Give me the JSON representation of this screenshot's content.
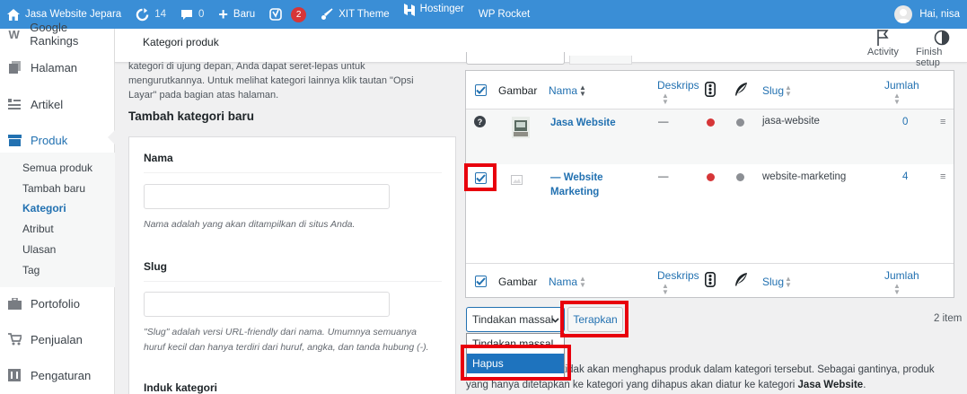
{
  "adminbar": {
    "site_name": "Jasa Website Jepara",
    "updates_count": "14",
    "comments_count": "0",
    "new_label": "Baru",
    "yoast_badge": "2",
    "xit_theme": "XIT Theme",
    "hostinger": "Hostinger",
    "wp_rocket": "WP Rocket",
    "greeting": "Hai, nisa"
  },
  "sidebar": {
    "items": [
      {
        "label": "Google Rankings",
        "icon": "w-icon"
      },
      {
        "label": "Halaman",
        "icon": "page-icon"
      },
      {
        "label": "Artikel",
        "icon": "post-icon"
      },
      {
        "label": "Produk",
        "icon": "product-icon"
      },
      {
        "label": "Portofolio",
        "icon": "briefcase-icon"
      },
      {
        "label": "Penjualan",
        "icon": "cart-icon"
      },
      {
        "label": "Pengaturan",
        "icon": "settings-icon"
      }
    ],
    "submenu": [
      "Semua produk",
      "Tambah baru",
      "Kategori",
      "Atribut",
      "Ulasan",
      "Tag"
    ]
  },
  "header": {
    "title": "Kategori produk",
    "activity": "Activity",
    "finish_setup": "Finish setup"
  },
  "left": {
    "help_text": "kategori di ujung depan, Anda dapat seret-lepas untuk mengurutkannya. Untuk melihat kategori lainnya klik tautan \"Opsi Layar\" pada bagian atas halaman.",
    "section_title": "Tambah kategori baru",
    "name_label": "Nama",
    "name_desc": "Nama adalah yang akan ditampilkan di situs Anda.",
    "slug_label": "Slug",
    "slug_desc": "\"Slug\" adalah versi URL-friendly dari nama. Umumnya semuanya huruf kecil dan hanya terdiri dari huruf, angka, dan tanda hubung (-).",
    "parent_label_partial": "Induk kategori"
  },
  "table": {
    "columns": {
      "image": "Gambar",
      "name": "Nama",
      "description": "Deskrips",
      "slug": "Slug",
      "count": "Jumlah"
    },
    "rows": [
      {
        "name": "Jasa Website",
        "description": "—",
        "slug": "jasa-website",
        "count": "0"
      },
      {
        "name": "— Website Marketing",
        "description": "—",
        "slug": "website-marketing",
        "count": "4"
      }
    ]
  },
  "bulk": {
    "select_value": "Tindakan massal",
    "apply": "Terapkan",
    "options": [
      "Tindakan massal",
      "Hapus"
    ],
    "item_count": "2 item"
  },
  "note": {
    "text_a": "Menghapus kategori tidak akan menghapus produk dalam kategori tersebut. Sebagai gantinya, produk yang hanya ditetapkan ke kategori yang dihapus akan diatur ke kategori ",
    "default_category": "Jasa Website",
    "text_b": "."
  },
  "colors": {
    "adminbar": "#3a8ed6",
    "link": "#2271b1",
    "highlight": "#e8000d",
    "dot_red": "#d63638",
    "dot_grey": "#8c8f94",
    "selected_option": "#1e73be"
  }
}
